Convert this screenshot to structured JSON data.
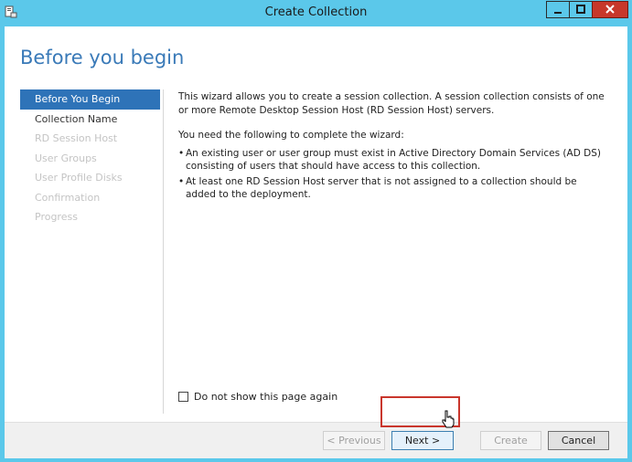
{
  "window": {
    "title": "Create Collection",
    "icon": "server-manager-icon",
    "controls": [
      "minimize-icon",
      "maximize-icon",
      "close-icon"
    ]
  },
  "page": {
    "heading": "Before you begin"
  },
  "nav": {
    "items": [
      {
        "label": "Before You Begin",
        "state": "active"
      },
      {
        "label": "Collection Name",
        "state": "enabled"
      },
      {
        "label": "RD Session Host",
        "state": "disabled"
      },
      {
        "label": "User Groups",
        "state": "disabled"
      },
      {
        "label": "User Profile Disks",
        "state": "disabled"
      },
      {
        "label": "Confirmation",
        "state": "disabled"
      },
      {
        "label": "Progress",
        "state": "disabled"
      }
    ]
  },
  "content": {
    "intro": "This wizard allows you to create a session collection. A session collection consists of one or more Remote Desktop Session Host (RD Session Host) servers.",
    "requirements_heading": "You need the following to complete the wizard:",
    "bullets": [
      "An existing user or user group must exist in Active Directory Domain Services (AD DS) consisting of users that should have access to this collection.",
      "At least one RD Session Host server that is not assigned to a collection should be added to the deployment."
    ],
    "checkbox_label": "Do not show this page again",
    "checkbox_checked": false
  },
  "footer": {
    "previous_label": "< Previous",
    "next_label": "Next >",
    "create_label": "Create",
    "cancel_label": "Cancel"
  },
  "colors": {
    "titlebar": "#5bc8ea",
    "accent": "#2e73b8",
    "heading": "#3a7ab8",
    "close": "#c7382b",
    "highlight": "#c9362c"
  }
}
